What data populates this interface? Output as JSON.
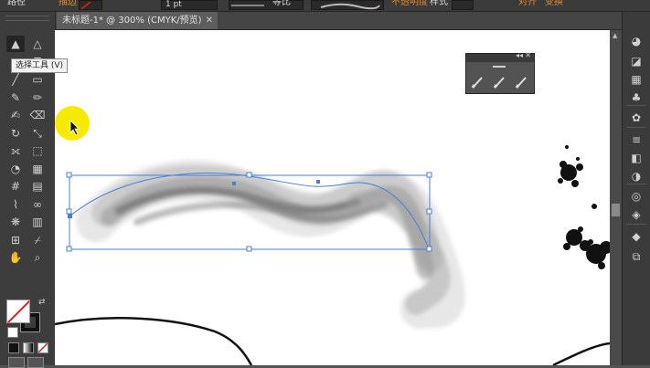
{
  "control_bar": {
    "path_label": "路径",
    "stroke_label": "描边",
    "stroke_weight": "1 pt",
    "stroke_profile": "等比",
    "opacity_label": "不透明度",
    "style_label": "样式",
    "align_label": "对齐",
    "transform_label": "变换"
  },
  "document": {
    "tab_title": "未标题-1* @ 300% (CMYK/预览)",
    "close_glyph": "✕"
  },
  "tooltip": {
    "text": "选择工具 (V)"
  },
  "float_panel": {
    "expand_glyph": "◂◂",
    "close_glyph": "✕"
  },
  "tools": [
    {
      "name": "selection-tool",
      "glyph": "▲"
    },
    {
      "name": "direct-selection-tool",
      "glyph": "△"
    },
    {
      "name": "pen-tool",
      "glyph": "✒"
    },
    {
      "name": "type-tool",
      "glyph": "T"
    },
    {
      "name": "line-tool",
      "glyph": "╱"
    },
    {
      "name": "rectangle-tool",
      "glyph": "▭"
    },
    {
      "name": "paintbrush-tool",
      "glyph": "✎"
    },
    {
      "name": "pencil-tool",
      "glyph": "✏"
    },
    {
      "name": "blob-brush-tool",
      "glyph": "✍"
    },
    {
      "name": "eraser-tool",
      "glyph": "⌫"
    },
    {
      "name": "rotate-tool",
      "glyph": "↻"
    },
    {
      "name": "scale-tool",
      "glyph": "⤡"
    },
    {
      "name": "width-tool",
      "glyph": "⟗"
    },
    {
      "name": "free-transform-tool",
      "glyph": "⬚"
    },
    {
      "name": "shape-builder-tool",
      "glyph": "◔"
    },
    {
      "name": "perspective-grid-tool",
      "glyph": "▦"
    },
    {
      "name": "mesh-tool",
      "glyph": "#"
    },
    {
      "name": "gradient-tool",
      "glyph": "▤"
    },
    {
      "name": "eyedropper-tool",
      "glyph": "⌇"
    },
    {
      "name": "blend-tool",
      "glyph": "∞"
    },
    {
      "name": "symbol-sprayer-tool",
      "glyph": "❋"
    },
    {
      "name": "column-graph-tool",
      "glyph": "▥"
    },
    {
      "name": "artboard-tool",
      "glyph": "⊞"
    },
    {
      "name": "slice-tool",
      "glyph": "⌿"
    },
    {
      "name": "hand-tool",
      "glyph": "✋"
    },
    {
      "name": "zoom-tool",
      "glyph": "⌕"
    }
  ],
  "dock_icons": [
    {
      "name": "color-icon",
      "glyph": "◕"
    },
    {
      "name": "color-guide-icon",
      "glyph": "◪"
    },
    {
      "name": "swatches-icon",
      "glyph": "▦"
    },
    {
      "name": "brushes-icon",
      "glyph": "♣"
    },
    {
      "name": "symbols-icon",
      "glyph": "✿"
    },
    {
      "name": "stroke-icon",
      "glyph": "≡"
    },
    {
      "name": "gradient-icon",
      "glyph": "◧"
    },
    {
      "name": "transparency-icon",
      "glyph": "◑"
    },
    {
      "name": "appearance-icon",
      "glyph": "◎"
    },
    {
      "name": "graphic-styles-icon",
      "glyph": "◈"
    },
    {
      "name": "layers-icon",
      "glyph": "◆"
    },
    {
      "name": "artboards-icon",
      "glyph": "⧉"
    }
  ],
  "colors": {
    "canvas": "#ffffff",
    "workspace": "#535353",
    "selection": "#4a7fd6",
    "accent_label": "#e48a2b",
    "cursor_highlight": "#f5ea00"
  }
}
